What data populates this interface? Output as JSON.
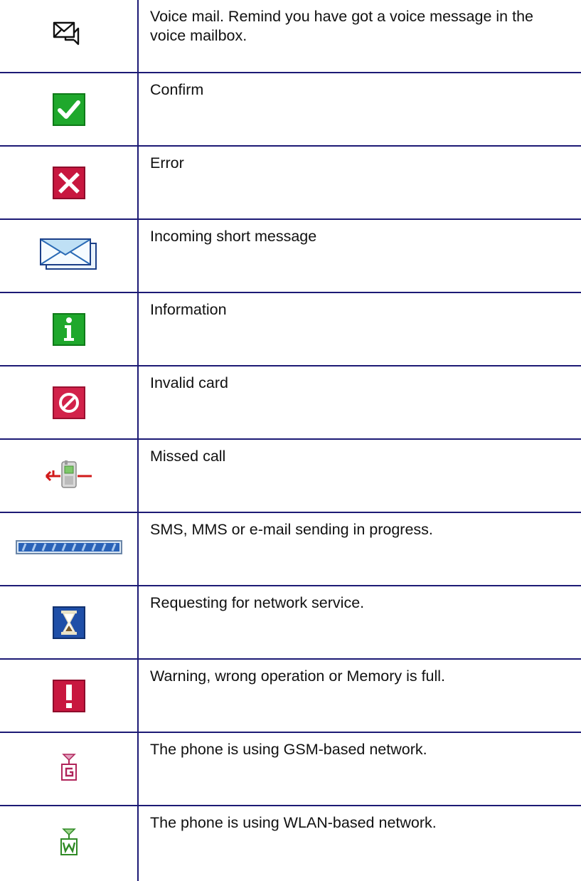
{
  "rows": [
    {
      "icon": "voice-mail-icon",
      "text": "Voice mail. Remind you have got a voice message in the voice mailbox."
    },
    {
      "icon": "confirm-check-icon",
      "text": "Confirm",
      "color": "#1fa82c"
    },
    {
      "icon": "error-x-icon",
      "text": "Error",
      "color": "#c8173f"
    },
    {
      "icon": "incoming-sms-envelope-icon",
      "text": "Incoming short message"
    },
    {
      "icon": "information-icon",
      "text": "Information",
      "color": "#1fa82c"
    },
    {
      "icon": "invalid-card-icon",
      "text": "Invalid card",
      "color": "#c8173f"
    },
    {
      "icon": "missed-call-icon",
      "text": "Missed call"
    },
    {
      "icon": "sending-progress-bar-icon",
      "text": "SMS, MMS or e-mail sending in progress."
    },
    {
      "icon": "hourglass-icon",
      "text": "Requesting for network service.",
      "color": "#1f4fa8"
    },
    {
      "icon": "warning-exclamation-icon",
      "text": "Warning, wrong operation or Memory is full.",
      "color": "#c8173f"
    },
    {
      "icon": "gsm-network-icon",
      "text": "The phone is using GSM-based network."
    },
    {
      "icon": "wlan-network-icon",
      "text": "The phone is using WLAN-based network."
    }
  ]
}
